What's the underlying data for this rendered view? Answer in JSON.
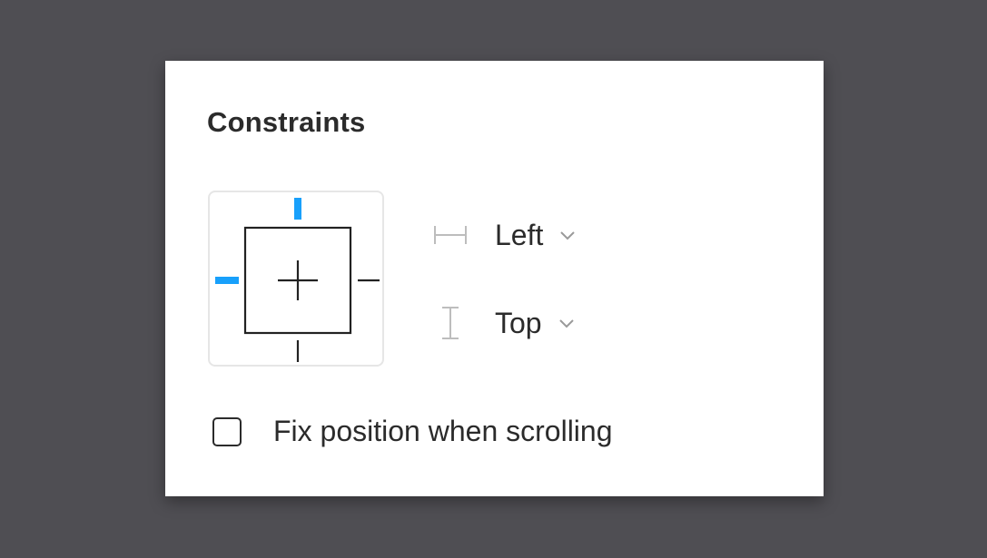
{
  "panel": {
    "title": "Constraints"
  },
  "constraint_widget": {
    "active_color": "#18a0fb",
    "inactive_color": "#222222",
    "top_active": true,
    "left_active": true,
    "right_active": false,
    "bottom_active": false
  },
  "horizontal": {
    "icon": "horizontal-constraint-icon",
    "value": "Left"
  },
  "vertical": {
    "icon": "vertical-constraint-icon",
    "value": "Top"
  },
  "fix_position": {
    "label": "Fix position when scrolling",
    "checked": false
  }
}
